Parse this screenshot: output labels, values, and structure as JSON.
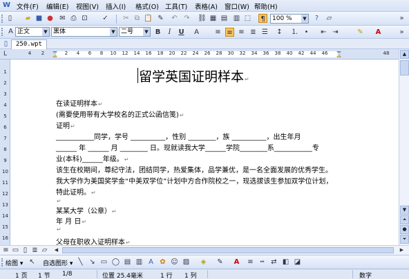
{
  "menubar": {
    "items": [
      "文件(F)",
      "编辑(E)",
      "视图(V)",
      "插入(I)",
      "格式(O)",
      "工具(T)",
      "表格(A)",
      "窗口(W)",
      "帮助(H)"
    ]
  },
  "toolbar": {
    "zoom": "100 %"
  },
  "format_bar": {
    "style": "正文",
    "font": "黑体",
    "size": "二号",
    "bold": "B",
    "italic": "I",
    "underline": "U"
  },
  "doc_tab": "250.wpt",
  "ruler": {
    "numbers": [
      "2",
      "4",
      "6",
      "8",
      "10",
      "12",
      "14",
      "16",
      "18",
      "20",
      "22",
      "24",
      "26",
      "28",
      "30",
      "32",
      "34",
      "36",
      "38",
      "40",
      "42",
      "44",
      "46",
      "48"
    ],
    "left_numbers": [
      "4",
      "2"
    ],
    "vertical": [
      "1",
      "2",
      "3",
      "4",
      "5",
      "6",
      "7",
      "8",
      "9",
      "10",
      "11",
      "12",
      "13",
      "14",
      "15",
      "16",
      "17"
    ]
  },
  "document": {
    "title": "留学英国证明样本",
    "lines": [
      "在读证明样本",
      "(需要使用带有大学校名的正式公函信笺)",
      "证明",
      "___________同学，学号 __________，性别 ________，族 __________，出生年月",
      "______ 年 ______ 月 ________ 日。现就读我大学______学院________系___________专",
      "业(本科)______年级。",
      "该生在校期间，尊纪守法，团结同学，热爱集体，品学兼优，是一名全面发展的优秀学生。",
      "我大学作为美国奖学金“中美双学位”计划中方合作院校之一，现选拔该生参加双学位计划，",
      "特此证明。",
      "",
      "某某大学（公章）",
      "年 月 日",
      "",
      "父母在职收入证明样本"
    ],
    "return_mark": "↵"
  },
  "drawbar": {
    "draw_label": "绘图",
    "autoshapes_label": "自选图形"
  },
  "status": {
    "page": "1 页",
    "section": "1 节",
    "page_of": "1/8",
    "position": "位置 25.4毫米",
    "line": "1 行",
    "col": "1 列",
    "mode": "数字"
  },
  "colors": {
    "toolbar_bg": "#d6e2f6",
    "accent_blue": "#316ac5"
  }
}
